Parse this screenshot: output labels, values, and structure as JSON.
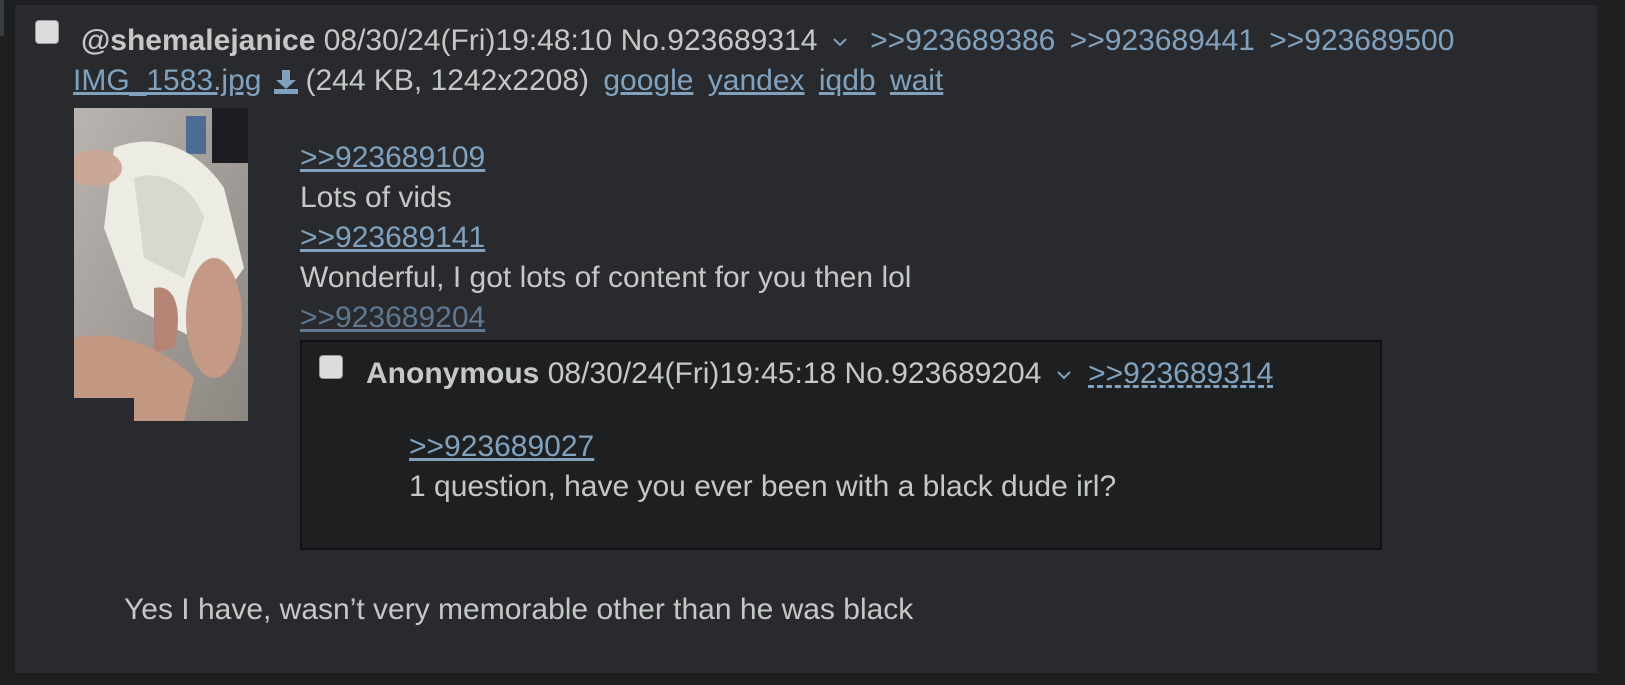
{
  "post": {
    "name": "@shemalejanice",
    "datetime": "08/30/24(Fri)19:48:10",
    "number": "No.923689314",
    "backlinks": [
      ">>923689386",
      ">>923689441",
      ">>923689500"
    ],
    "file": {
      "filename": "IMG_1583.jpg",
      "info": "(244 KB, 1242x2208)",
      "search_links": [
        "google",
        "yandex",
        "iqdb",
        "wait"
      ]
    },
    "lines": [
      {
        "type": "quote",
        "text": ">>923689109"
      },
      {
        "type": "text",
        "text": "Lots of vids"
      },
      {
        "type": "quote",
        "text": ">>923689141"
      },
      {
        "type": "text",
        "text": "Wonderful, I got lots of content for you then lol"
      },
      {
        "type": "quote-expanded",
        "text": ">>923689204"
      }
    ],
    "inline_reply": {
      "name": "Anonymous",
      "datetime": "08/30/24(Fri)19:45:18",
      "number": "No.923689204",
      "backlink": ">>923689314",
      "quote": ">>923689027",
      "text": "1 question, have you ever been with a black dude irl?"
    },
    "closing_text": "Yes I have, wasn’t very memorable other than he was black"
  },
  "colors": {
    "background": "#1d1f21",
    "post_bg": "#282a2e",
    "text": "#c5c8c6",
    "link": "#81a2be"
  },
  "icons": [
    "chevron-down-icon",
    "download-icon"
  ]
}
